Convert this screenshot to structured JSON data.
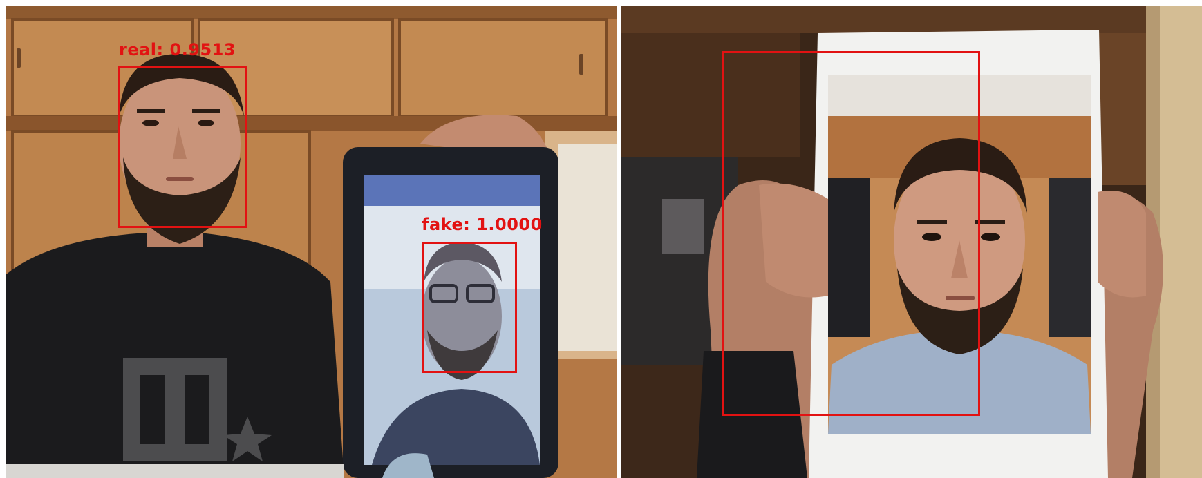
{
  "detections": {
    "left_real": {
      "label": "real: 0.9513",
      "class": "real",
      "score": 0.9513,
      "color": "#e21212"
    },
    "left_fake": {
      "label": "fake: 1.0000",
      "class": "fake",
      "score": 1.0,
      "color": "#e21212"
    },
    "right_fake": {
      "label": "",
      "color": "#e21212"
    }
  },
  "colors": {
    "box": "#e21212",
    "wood": "#b57a45",
    "wall_dark": "#3a2618",
    "shirt": "#1b1b1d",
    "skin": "#c9947a",
    "tablet": "#1c1f26",
    "screen": "#b9c9dc",
    "paper": "#f2f2f0"
  },
  "icons": [
    "dc-logo-shirt-print",
    "watch-band"
  ]
}
